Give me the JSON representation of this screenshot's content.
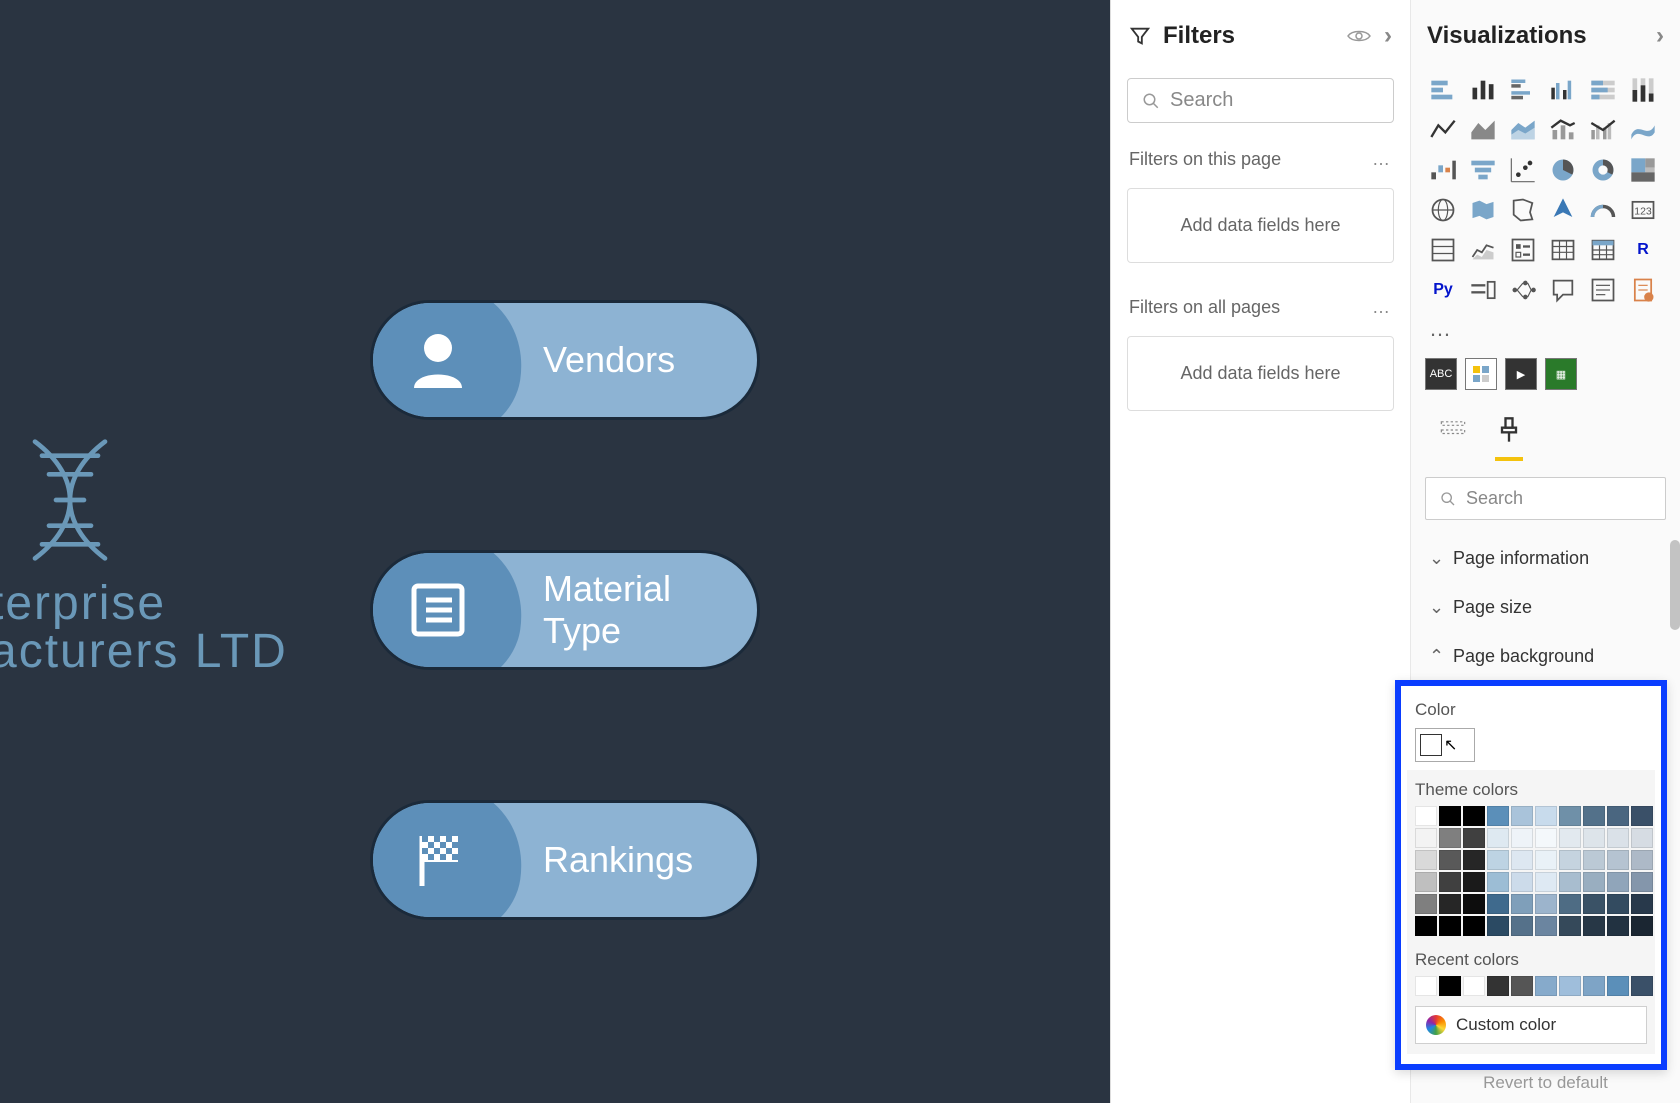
{
  "canvas": {
    "logo_line1": "terprise",
    "logo_line2": "acturers LTD",
    "buttons": [
      {
        "label": "Vendors",
        "icon": "user-icon"
      },
      {
        "label": "Material Type",
        "icon": "list-icon"
      },
      {
        "label": "Rankings",
        "icon": "flag-icon"
      }
    ]
  },
  "filters": {
    "title": "Filters",
    "search_placeholder": "Search",
    "section1_title": "Filters on this page",
    "section1_placeholder": "Add data fields here",
    "section2_title": "Filters on all pages",
    "section2_placeholder": "Add data fields here"
  },
  "viz": {
    "title": "Visualizations",
    "search_placeholder": "Search",
    "accordion": {
      "page_info": "Page information",
      "page_size": "Page size",
      "page_bg": "Page background",
      "color_label": "Color"
    },
    "revert_label": "Revert to default"
  },
  "color_picker": {
    "label": "Color",
    "theme_title": "Theme colors",
    "recent_title": "Recent colors",
    "custom_label": "Custom color",
    "theme_row": [
      "#ffffff",
      "#000000",
      "#000000",
      "#5b8fb9",
      "#a9c3da",
      "#c8dbec",
      "#6f90a8",
      "#53718a",
      "#4a6680",
      "#3a5068"
    ],
    "theme_cols": [
      [
        "#ffffff",
        "#f3f3f3",
        "#d9d9d9",
        "#bfbfbf",
        "#7f7f7f",
        "#000000"
      ],
      [
        "#000000",
        "#7f7f7f",
        "#595959",
        "#404040",
        "#262626",
        "#000000"
      ],
      [
        "#000000",
        "#404040",
        "#262626",
        "#1a1a1a",
        "#0d0d0d",
        "#000000"
      ],
      [
        "#5b8fb9",
        "#dee9f1",
        "#bdd3e3",
        "#9cbdd5",
        "#3f6a8d",
        "#2b4a63"
      ],
      [
        "#a9c3da",
        "#eef3f8",
        "#dde7f1",
        "#ccdbea",
        "#7f9fba",
        "#55718a"
      ],
      [
        "#c8dbec",
        "#f4f8fb",
        "#e9f1f7",
        "#dee9f3",
        "#9cb4cc",
        "#6b85a0"
      ],
      [
        "#6f90a8",
        "#e2e9ef",
        "#c5d3df",
        "#a8bdcf",
        "#4e6c84",
        "#35495a"
      ],
      [
        "#53718a",
        "#dde4ea",
        "#bbc9d5",
        "#99aec0",
        "#3a5266",
        "#273746"
      ],
      [
        "#4a6680",
        "#dae1e8",
        "#b5c3d1",
        "#90a5ba",
        "#334b60",
        "#223241"
      ],
      [
        "#3a5068",
        "#d6dce3",
        "#adb9c7",
        "#8496ab",
        "#28394b",
        "#1b2632"
      ]
    ],
    "recent": [
      "#ffffff",
      "#000000",
      "#ffffff",
      "#333333",
      "#555555",
      "#86aacb",
      "#9fbedb",
      "#7ea4c6",
      "#5b8fb9",
      "#3a5068"
    ]
  }
}
